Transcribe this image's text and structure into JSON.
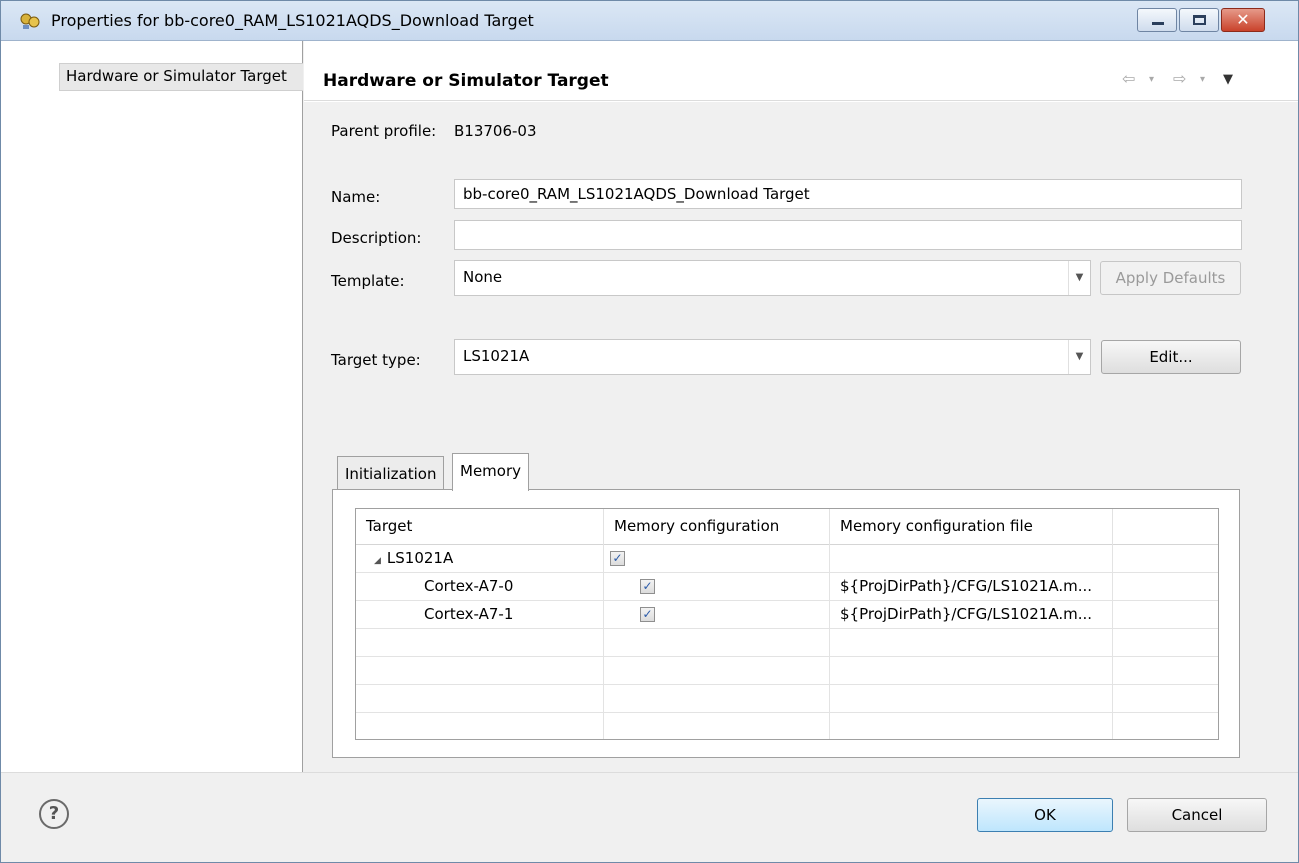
{
  "window": {
    "title": "Properties for bb-core0_RAM_LS1021AQDS_Download Target",
    "icon": "eclipse-properties-icon",
    "close_glyph": "✕"
  },
  "nav": {
    "selected_item": "Hardware or Simulator Target"
  },
  "page": {
    "title": "Hardware or Simulator Target",
    "history_back": "⇦",
    "history_forward": "⇨",
    "dropdown_glyph": "▾",
    "view_menu_glyph": "▼"
  },
  "form": {
    "parent_profile_label": "Parent profile:",
    "parent_profile_value": "B13706-03",
    "name_label": "Name:",
    "name_value": "bb-core0_RAM_LS1021AQDS_Download Target",
    "description_label": "Description:",
    "description_value": "",
    "template_label": "Template:",
    "template_value": "None",
    "apply_defaults_label": "Apply Defaults",
    "target_type_label": "Target type:",
    "target_type_value": "LS1021A",
    "edit_label": "Edit...",
    "combo_arrow": "▼"
  },
  "tabs": [
    {
      "label": "Initialization",
      "active": false
    },
    {
      "label": "Memory",
      "active": true
    }
  ],
  "memory_table": {
    "columns": [
      "Target",
      "Memory configuration",
      "Memory configuration file",
      ""
    ],
    "expander_glyph": "◢",
    "check_glyph": "✓",
    "rows": [
      {
        "target": "LS1021A",
        "checked": true,
        "file": ""
      },
      {
        "target": "Cortex-A7-0",
        "checked": true,
        "file": "${ProjDirPath}/CFG/LS1021A.m..."
      },
      {
        "target": "Cortex-A7-1",
        "checked": true,
        "file": "${ProjDirPath}/CFG/LS1021A.m..."
      }
    ]
  },
  "footer": {
    "help_glyph": "?",
    "ok_label": "OK",
    "cancel_label": "Cancel"
  },
  "colors": {
    "title_bar": "#c8d9ee",
    "close_button": "#c9422b",
    "default_button": "#bee6fd",
    "checkbox_mark": "#2a5aa8"
  }
}
